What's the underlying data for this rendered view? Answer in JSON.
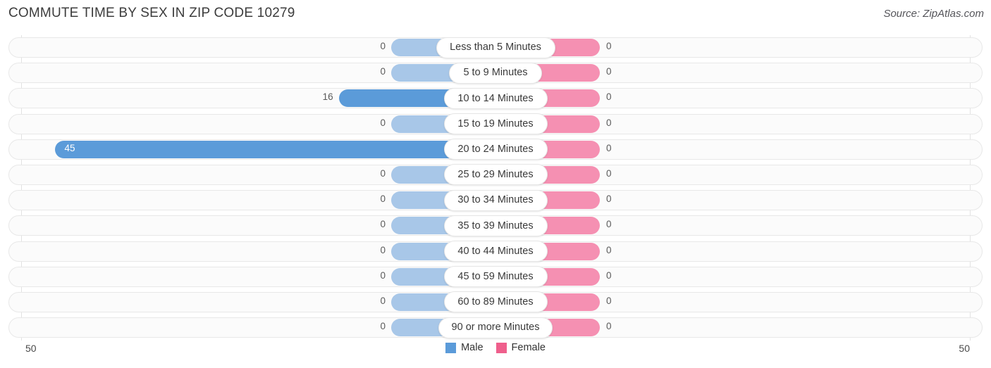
{
  "header": {
    "title": "COMMUTE TIME BY SEX IN ZIP CODE 10279",
    "source": "Source: ZipAtlas.com"
  },
  "axis": {
    "left_label": "50",
    "right_label": "50"
  },
  "legend": {
    "items": [
      {
        "label": "Male",
        "color": "#5b9bd9",
        "key": "male"
      },
      {
        "label": "Female",
        "color": "#ef5f8c",
        "key": "female"
      }
    ]
  },
  "colors": {
    "male_strong": "#5b9bd9",
    "male_light": "#a8c7e8",
    "female_strong": "#ef5f8c",
    "female_light": "#f590b2",
    "track_bg": "#fbfbfb",
    "track_border": "#e8e8e8",
    "gridline": "#e2e2e2",
    "title_text": "#3c3c3c"
  },
  "chart_data": {
    "type": "bar",
    "orientation": "horizontal-diverging",
    "title": "COMMUTE TIME BY SEX IN ZIP CODE 10279",
    "xlabel": "",
    "ylabel": "",
    "xlim": [
      50,
      50
    ],
    "axis_left_max": 50,
    "axis_right_max": 50,
    "grid": true,
    "legend_position": "bottom-center",
    "categories": [
      "Less than 5 Minutes",
      "5 to 9 Minutes",
      "10 to 14 Minutes",
      "15 to 19 Minutes",
      "20 to 24 Minutes",
      "25 to 29 Minutes",
      "30 to 34 Minutes",
      "35 to 39 Minutes",
      "40 to 44 Minutes",
      "45 to 59 Minutes",
      "60 to 89 Minutes",
      "90 or more Minutes"
    ],
    "series": [
      {
        "name": "Male",
        "values": [
          0,
          0,
          16,
          0,
          45,
          0,
          0,
          0,
          0,
          0,
          0,
          0
        ]
      },
      {
        "name": "Female",
        "values": [
          0,
          0,
          0,
          0,
          0,
          0,
          0,
          0,
          0,
          0,
          0,
          0
        ]
      }
    ]
  },
  "rows": [
    {
      "label": "Less than 5 Minutes",
      "male": 0,
      "female": 0,
      "male_text": "0",
      "female_text": "0"
    },
    {
      "label": "5 to 9 Minutes",
      "male": 0,
      "female": 0,
      "male_text": "0",
      "female_text": "0"
    },
    {
      "label": "10 to 14 Minutes",
      "male": 16,
      "female": 0,
      "male_text": "16",
      "female_text": "0"
    },
    {
      "label": "15 to 19 Minutes",
      "male": 0,
      "female": 0,
      "male_text": "0",
      "female_text": "0"
    },
    {
      "label": "20 to 24 Minutes",
      "male": 45,
      "female": 0,
      "male_text": "45",
      "female_text": "0"
    },
    {
      "label": "25 to 29 Minutes",
      "male": 0,
      "female": 0,
      "male_text": "0",
      "female_text": "0"
    },
    {
      "label": "30 to 34 Minutes",
      "male": 0,
      "female": 0,
      "male_text": "0",
      "female_text": "0"
    },
    {
      "label": "35 to 39 Minutes",
      "male": 0,
      "female": 0,
      "male_text": "0",
      "female_text": "0"
    },
    {
      "label": "40 to 44 Minutes",
      "male": 0,
      "female": 0,
      "male_text": "0",
      "female_text": "0"
    },
    {
      "label": "45 to 59 Minutes",
      "male": 0,
      "female": 0,
      "male_text": "0",
      "female_text": "0"
    },
    {
      "label": "60 to 89 Minutes",
      "male": 0,
      "female": 0,
      "male_text": "0",
      "female_text": "0"
    },
    {
      "label": "90 or more Minutes",
      "male": 0,
      "female": 0,
      "male_text": "0",
      "female_text": "0"
    }
  ]
}
